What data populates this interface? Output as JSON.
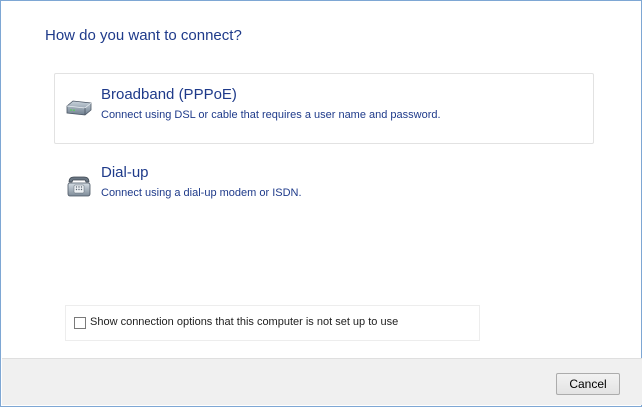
{
  "wizard": {
    "heading": "How do you want to connect?"
  },
  "options": [
    {
      "title": "Broadband (PPPoE)",
      "description": "Connect using DSL or cable that requires a user name and password.",
      "icon": "modem-icon"
    },
    {
      "title": "Dial-up",
      "description": "Connect using a dial-up modem or ISDN.",
      "icon": "telephone-icon"
    }
  ],
  "show_options": {
    "label": "Show connection options that this computer is not set up to use",
    "checked": false
  },
  "footer": {
    "cancel_label": "Cancel"
  },
  "colors": {
    "accent_text": "#1e3a8a",
    "window_border": "#7ea7d4",
    "footer_bg": "#f0f0f0"
  }
}
